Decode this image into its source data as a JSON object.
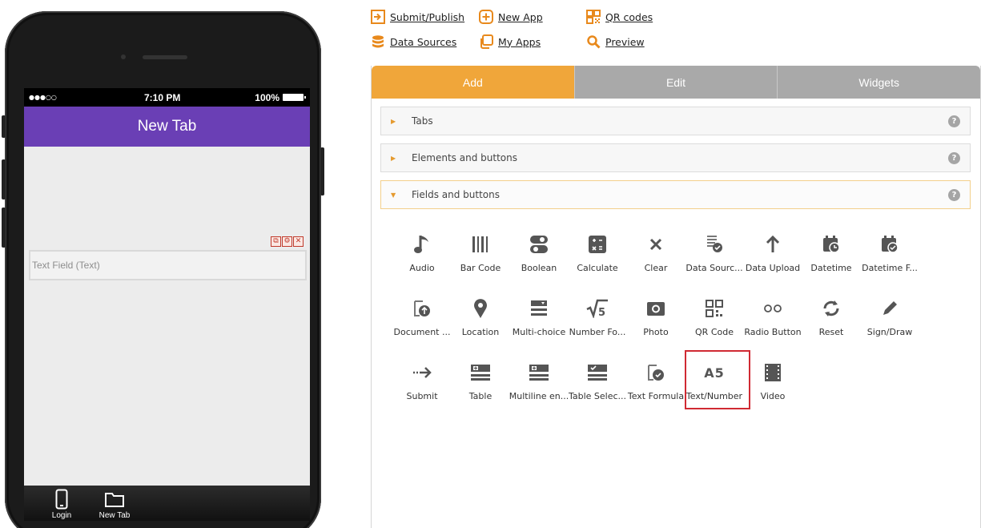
{
  "phone": {
    "status": {
      "signal": "●●●○○",
      "time": "7:10 PM",
      "battery": "100%"
    },
    "header_title": "New Tab",
    "text_field_label": "Text Field (Text)",
    "field_tools": [
      "copy",
      "settings",
      "delete"
    ],
    "tabs": [
      {
        "label": "Login",
        "icon": "phone-icon"
      },
      {
        "label": "New Tab",
        "icon": "folder-icon"
      }
    ]
  },
  "toplinks": {
    "submit": "Submit/Publish",
    "new_app": "New App",
    "qr_codes": "QR codes",
    "data_sources": "Data Sources",
    "my_apps": "My Apps",
    "preview": "Preview"
  },
  "panel": {
    "tabs": [
      "Add",
      "Edit",
      "Widgets"
    ],
    "active_tab": "Add",
    "sections": [
      {
        "label": "Tabs",
        "open": false
      },
      {
        "label": "Elements and buttons",
        "open": false
      },
      {
        "label": "Fields and buttons",
        "open": true
      }
    ],
    "help_glyph": "?",
    "items_row1": [
      "Audio",
      "Bar Code",
      "Boolean",
      "Calculate",
      "Clear",
      "Data Sourc...",
      "Data Upload",
      "Datetime",
      "Datetime F..."
    ],
    "items_row2": [
      "Document ...",
      "Location",
      "Multi-choice",
      "Number Fo...",
      "Photo",
      "QR Code",
      "Radio Button",
      "Reset",
      "Sign/Draw"
    ],
    "items_row3": [
      "Submit",
      "Table",
      "Multiline en...",
      "Table Selec...",
      "Text Formula",
      "Text/Number",
      "Video"
    ],
    "text_number_glyph": "A5",
    "highlighted_item": "Text/Number"
  },
  "colors": {
    "accent_orange": "#f0a63a",
    "app_header_purple": "#6a3fb5",
    "highlight_red": "#d02a33",
    "inactive_tab_gray": "#a9a9a9"
  }
}
